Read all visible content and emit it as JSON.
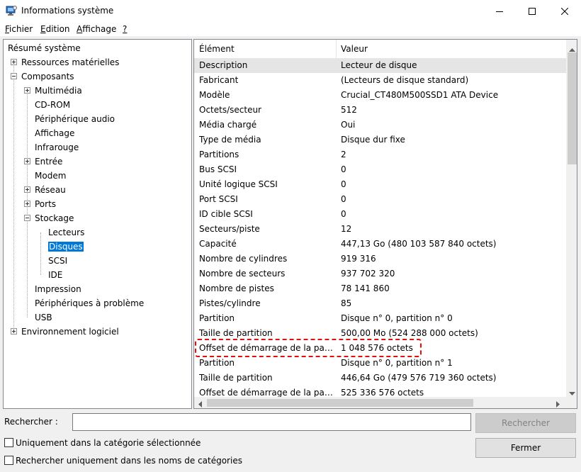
{
  "window": {
    "title": "Informations système"
  },
  "menu": [
    {
      "pre": "",
      "ul": "F",
      "post": "ichier"
    },
    {
      "pre": "",
      "ul": "E",
      "post": "dition"
    },
    {
      "pre": "",
      "ul": "A",
      "post": "ffichage"
    },
    {
      "pre": "",
      "ul": "?",
      "post": ""
    }
  ],
  "tree": {
    "root": "Résumé système",
    "items": [
      {
        "label": "Ressources matérielles",
        "expander": "plus"
      },
      {
        "label": "Composants",
        "expander": "minus"
      },
      {
        "label": "Multimédia",
        "expander": "plus"
      },
      {
        "label": "CD-ROM"
      },
      {
        "label": "Périphérique audio"
      },
      {
        "label": "Affichage"
      },
      {
        "label": "Infrarouge"
      },
      {
        "label": "Entrée",
        "expander": "plus"
      },
      {
        "label": "Modem"
      },
      {
        "label": "Réseau",
        "expander": "plus"
      },
      {
        "label": "Ports",
        "expander": "plus"
      },
      {
        "label": "Stockage",
        "expander": "minus"
      },
      {
        "label": "Lecteurs"
      },
      {
        "label": "Disques",
        "selected": true
      },
      {
        "label": "SCSI"
      },
      {
        "label": "IDE"
      },
      {
        "label": "Impression"
      },
      {
        "label": "Périphériques à problème"
      },
      {
        "label": "USB"
      },
      {
        "label": "Environnement logiciel",
        "expander": "plus"
      }
    ]
  },
  "list": {
    "columns": [
      "Élément",
      "Valeur"
    ],
    "rows": [
      [
        "Description",
        "Lecteur de disque"
      ],
      [
        "Fabricant",
        "(Lecteurs de disque standard)"
      ],
      [
        "Modèle",
        "Crucial_CT480M500SSD1 ATA Device"
      ],
      [
        "Octets/secteur",
        "512"
      ],
      [
        "Média chargé",
        "Oui"
      ],
      [
        "Type de média",
        "Disque dur fixe"
      ],
      [
        "Partitions",
        "2"
      ],
      [
        "Bus SCSI",
        "0"
      ],
      [
        "Unité logique SCSI",
        "0"
      ],
      [
        "Port SCSI",
        "0"
      ],
      [
        "ID cible SCSI",
        "0"
      ],
      [
        "Secteurs/piste",
        "12"
      ],
      [
        "Capacité",
        "447,13 Go (480 103 587 840 octets)"
      ],
      [
        "Nombre de cylindres",
        "919 316"
      ],
      [
        "Nombre de secteurs",
        "937 702 320"
      ],
      [
        "Nombre de pistes",
        "78 141 860"
      ],
      [
        "Pistes/cylindre",
        "85"
      ],
      [
        "Partition",
        "Disque n° 0, partition n° 0"
      ],
      [
        "Taille de partition",
        "500,00 Mo (524 288 000 octets)"
      ],
      [
        "Offset de démarrage de la partition",
        "1 048 576 octets"
      ],
      [
        "Partition",
        "Disque n° 0, partition n° 1"
      ],
      [
        "Taille de partition",
        "446,64 Go (479 576 719 360 octets)"
      ],
      [
        "Offset de démarrage de la partition",
        "525 336 576 octets"
      ]
    ]
  },
  "search": {
    "label": "Rechercher :",
    "value": "",
    "search_button": "Rechercher",
    "close_button": "Fermer",
    "option1": "Uniquement dans la catégorie sélectionnée",
    "option2": "Rechercher uniquement dans les noms de catégories"
  }
}
